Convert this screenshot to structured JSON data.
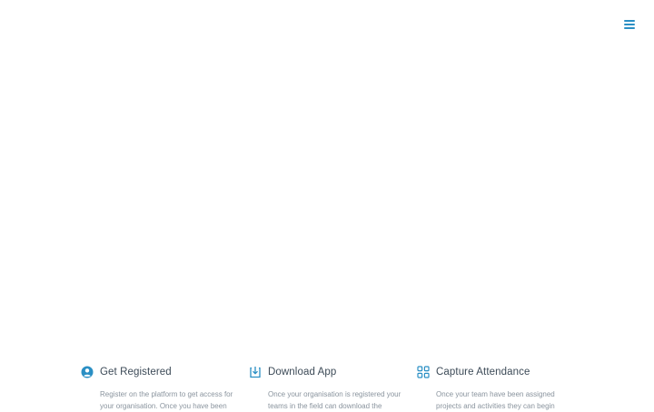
{
  "header": {
    "menu_icon": "hamburger-menu-icon",
    "accent_color": "#2a8fc4"
  },
  "features": [
    {
      "icon": "user-circle-icon",
      "title": "Get Registered",
      "text": "Register on the platform to get access for your organisation. Once you have been"
    },
    {
      "icon": "download-icon",
      "title": "Download App",
      "text": "Once your organisation is registered your teams in the field can download the"
    },
    {
      "icon": "grid-icon",
      "title": "Capture Attendance",
      "text": "Once your team have been assigned projects and activities they can begin"
    }
  ]
}
